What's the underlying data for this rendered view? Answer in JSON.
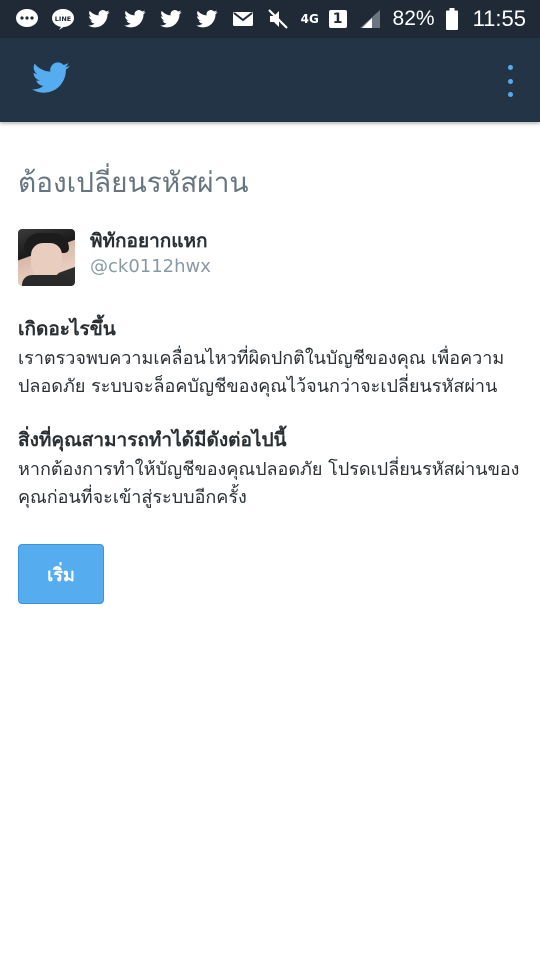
{
  "status_bar": {
    "left_icons": [
      "chat-bubble-icon",
      "line-icon",
      "twitter-bird-icon",
      "twitter-bird-icon",
      "twitter-bird-icon",
      "twitter-bird-icon",
      "mail-icon"
    ],
    "network": "4G",
    "sim": "1",
    "battery": "82%",
    "time": "11:55"
  },
  "app_bar": {
    "logo_icon": "twitter-bird-icon",
    "menu_icon": "overflow-menu-icon",
    "accent": "#55acee",
    "background": "#243447"
  },
  "page": {
    "title": "ต้องเปลี่ยนรหัสผ่าน"
  },
  "user": {
    "name": "พิทักอยากแหก",
    "handle": "@ck0112hwx"
  },
  "sections": [
    {
      "heading": "เกิดอะไรขึ้น",
      "body": "เราตรวจพบความเคลื่อนไหวที่ผิดปกติในบัญชีของคุณ เพื่อความปลอดภัย ระบบจะล็อคบัญชีของคุณไว้จนกว่าจะเปลี่ยนรหัสผ่าน"
    },
    {
      "heading": "สิ่งที่คุณสามารถทำได้มีดังต่อไปนี้",
      "body": "หากต้องการทำให้บัญชีของคุณปลอดภัย โปรดเปลี่ยนรหัสผ่านของคุณก่อนที่จะเข้าสู่ระบบอีกครั้ง"
    }
  ],
  "start_button": {
    "label": "เริ่ม",
    "color": "#55acee"
  }
}
